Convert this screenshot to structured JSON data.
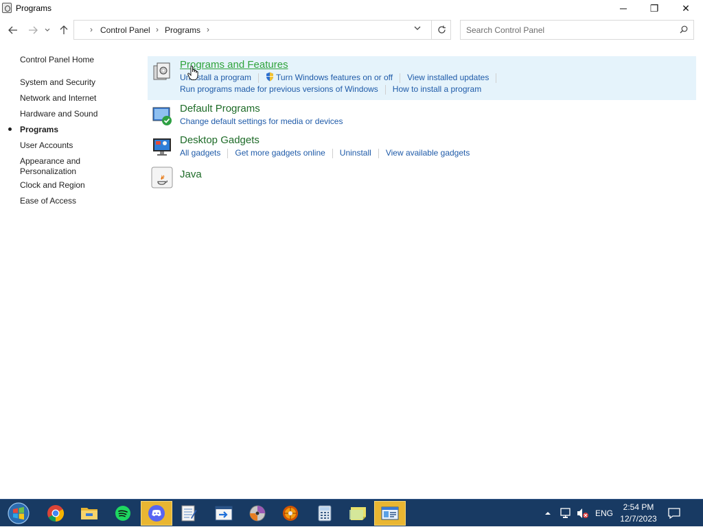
{
  "window": {
    "title": "Programs",
    "minimize": "─",
    "maximize": "❐",
    "close": "✕"
  },
  "address": {
    "crumbs": [
      "Control Panel",
      "Programs"
    ],
    "search_placeholder": "Search Control Panel"
  },
  "sidebar": {
    "items": [
      {
        "label": "Control Panel Home"
      },
      {
        "label": "System and Security"
      },
      {
        "label": "Network and Internet"
      },
      {
        "label": "Hardware and Sound"
      },
      {
        "label": "Programs",
        "active": true
      },
      {
        "label": "User Accounts"
      },
      {
        "label": "Appearance and Personalization"
      },
      {
        "label": "Clock and Region"
      },
      {
        "label": "Ease of Access"
      }
    ]
  },
  "categories": [
    {
      "title": "Programs and Features",
      "links_row1": [
        "Uninstall a program",
        "Turn Windows features on or off",
        "View installed updates"
      ],
      "links_row2": [
        "Run programs made for previous versions of Windows",
        "How to install a program"
      ]
    },
    {
      "title": "Default Programs",
      "links_row1": [
        "Change default settings for media or devices"
      ]
    },
    {
      "title": "Desktop Gadgets",
      "links_row1": [
        "All gadgets",
        "Get more gadgets online",
        "Uninstall",
        "View available gadgets"
      ]
    },
    {
      "title": "Java"
    }
  ],
  "taskbar": {
    "apps": [
      "start-orb",
      "chrome",
      "file-explorer",
      "spotify",
      "discord",
      "notepad",
      "remote-app",
      "media-disc",
      "system-tool",
      "calculator",
      "sticky-notes",
      "control-panel"
    ],
    "language": "ENG",
    "time": "2:54 PM",
    "date": "12/7/2023"
  }
}
